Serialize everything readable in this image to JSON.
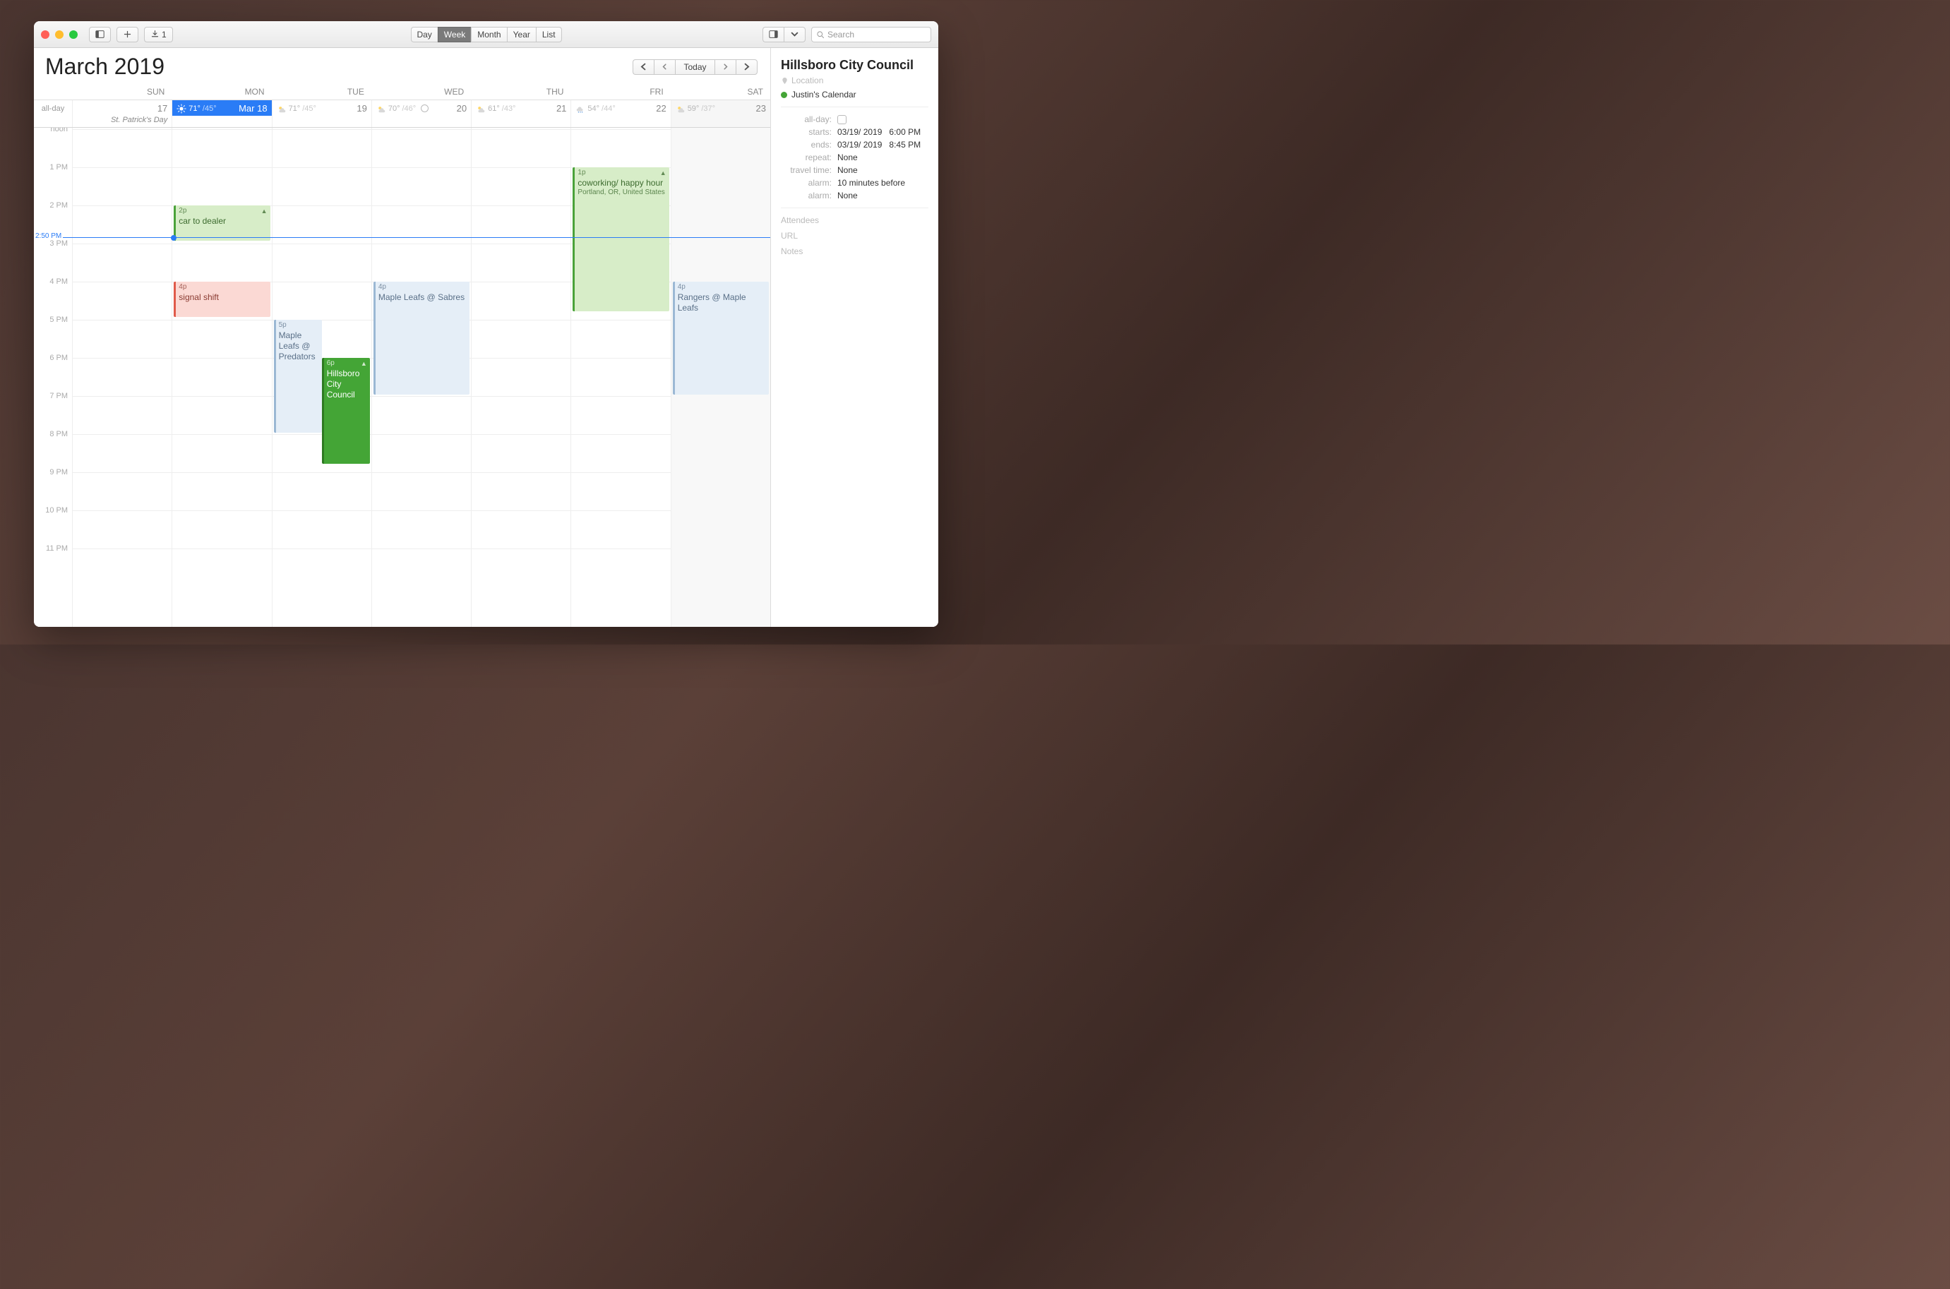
{
  "toolbar": {
    "download_count": "1",
    "views": [
      "Day",
      "Week",
      "Month",
      "Year",
      "List"
    ],
    "active_view": "Week",
    "search_placeholder": "Search"
  },
  "header": {
    "month": "March",
    "year": "2019",
    "today_label": "Today"
  },
  "dayNames": [
    "SUN",
    "MON",
    "TUE",
    "WED",
    "THU",
    "FRI",
    "SAT"
  ],
  "allday_label": "all-day",
  "days": [
    {
      "num": "17",
      "weather_hi": "",
      "weather_lo": "",
      "today": false,
      "label": "",
      "allday_event": "St. Patrick's Day"
    },
    {
      "num": "Mar 18",
      "weather_hi": "71°",
      "weather_lo": "/45°",
      "today": true,
      "label": ""
    },
    {
      "num": "19",
      "weather_hi": "71°",
      "weather_lo": "/45°",
      "today": false
    },
    {
      "num": "20",
      "weather_hi": "70°",
      "weather_lo": "/46°",
      "today": false,
      "moon": true
    },
    {
      "num": "21",
      "weather_hi": "61°",
      "weather_lo": "/43°",
      "today": false
    },
    {
      "num": "22",
      "weather_hi": "54°",
      "weather_lo": "/44°",
      "today": false
    },
    {
      "num": "23",
      "weather_hi": "59°",
      "weather_lo": "/37°",
      "today": false
    }
  ],
  "hours": [
    "noon",
    "1 PM",
    "2 PM",
    "3 PM",
    "4 PM",
    "5 PM",
    "6 PM",
    "7 PM",
    "8 PM",
    "9 PM",
    "10 PM",
    "11 PM"
  ],
  "now_label": "2:50 PM",
  "events": {
    "car_dealer": {
      "time": "2p",
      "title": "car to dealer"
    },
    "signal_shift": {
      "time": "4p",
      "title": "signal shift"
    },
    "leafs_predators": {
      "time": "5p",
      "title": "Maple Leafs @ Predators"
    },
    "hillsboro": {
      "time": "6p",
      "title": "Hillsboro City Council"
    },
    "leafs_sabres": {
      "time": "4p",
      "title": "Maple Leafs @ Sabres"
    },
    "coworking": {
      "time": "1p",
      "title": "coworking/ happy hour",
      "loc": "Portland, OR, United States"
    },
    "rangers": {
      "time": "4p",
      "title": "Rangers @ Maple Leafs"
    }
  },
  "inspector": {
    "title": "Hillsboro City Council",
    "location_ph": "Location",
    "calendar": "Justin's Calendar",
    "labels": {
      "allday": "all-day:",
      "starts": "starts:",
      "ends": "ends:",
      "repeat": "repeat:",
      "travel": "travel time:",
      "alarm": "alarm:"
    },
    "starts_date": "03/19/ 2019",
    "starts_time": "6:00 PM",
    "ends_date": "03/19/ 2019",
    "ends_time": "8:45 PM",
    "repeat": "None",
    "travel": "None",
    "alarm1": "10 minutes before",
    "alarm2": "None",
    "attendees_ph": "Attendees",
    "url_ph": "URL",
    "notes_ph": "Notes"
  }
}
